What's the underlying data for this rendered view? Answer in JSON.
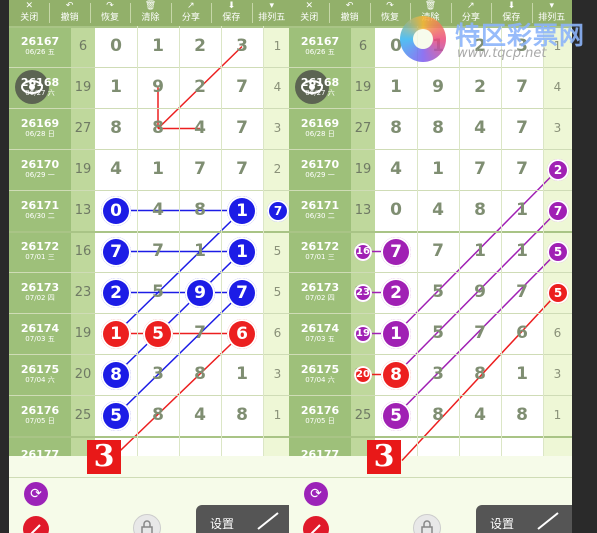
{
  "toolbar": {
    "buttons": [
      {
        "label": "关闭",
        "icon": "close-icon",
        "glyph": "✕"
      },
      {
        "label": "撤销",
        "icon": "undo-icon",
        "glyph": "↶"
      },
      {
        "label": "恢复",
        "icon": "redo-icon",
        "glyph": "↷"
      },
      {
        "label": "清除",
        "icon": "trash-icon",
        "glyph": "🗑"
      },
      {
        "label": "分享",
        "icon": "share-icon",
        "glyph": "↗"
      },
      {
        "label": "保存",
        "icon": "save-icon",
        "glyph": "⬇"
      },
      {
        "label": "排列五",
        "icon": "dropdown-icon",
        "glyph": "▾"
      }
    ]
  },
  "rows": [
    {
      "issue": "26167",
      "date": "06/26 五",
      "gap": "6",
      "digits": [
        "0",
        "1",
        "2",
        "3"
      ],
      "right": "1"
    },
    {
      "issue": "26168",
      "date": "06/27 六",
      "gap": "19",
      "digits": [
        "1",
        "9",
        "2",
        "7"
      ],
      "right": "4"
    },
    {
      "issue": "26169",
      "date": "06/28 日",
      "gap": "27",
      "digits": [
        "8",
        "8",
        "4",
        "7"
      ],
      "right": "3"
    },
    {
      "issue": "26170",
      "date": "06/29 一",
      "gap": "19",
      "digits": [
        "4",
        "1",
        "7",
        "7"
      ],
      "right": "2"
    },
    {
      "issue": "26171",
      "date": "06/30 二",
      "gap": "13",
      "digits": [
        "0",
        "4",
        "8",
        "1"
      ],
      "right": "7"
    },
    {
      "issue": "26172",
      "date": "07/01 三",
      "gap": "16",
      "digits": [
        "7",
        "7",
        "1",
        "1"
      ],
      "right": "5"
    },
    {
      "issue": "26173",
      "date": "07/02 四",
      "gap": "23",
      "digits": [
        "2",
        "5",
        "9",
        "7"
      ],
      "right": "5"
    },
    {
      "issue": "26174",
      "date": "07/03 五",
      "gap": "19",
      "digits": [
        "1",
        "5",
        "7",
        "6"
      ],
      "right": "6"
    },
    {
      "issue": "26175",
      "date": "07/04 六",
      "gap": "20",
      "digits": [
        "8",
        "3",
        "8",
        "1"
      ],
      "right": "3"
    },
    {
      "issue": "26176",
      "date": "07/05 日",
      "gap": "25",
      "digits": [
        "5",
        "8",
        "4",
        "8"
      ],
      "right": "1"
    },
    {
      "issue": "26177",
      "date": "",
      "gap": "",
      "digits": [
        "",
        "",
        "",
        ""
      ],
      "right": ""
    }
  ],
  "left_panel": {
    "highlight_balls": [
      {
        "row": 4,
        "col": 0,
        "value": "0",
        "color": "blue"
      },
      {
        "row": 4,
        "col": 3,
        "value": "1",
        "color": "blue"
      },
      {
        "row": 5,
        "col": 0,
        "value": "7",
        "color": "blue"
      },
      {
        "row": 5,
        "col": 3,
        "value": "1",
        "color": "blue"
      },
      {
        "row": 6,
        "col": 0,
        "value": "2",
        "color": "blue"
      },
      {
        "row": 6,
        "col": 2,
        "value": "9",
        "color": "blue"
      },
      {
        "row": 6,
        "col": 3,
        "value": "7",
        "color": "blue"
      },
      {
        "row": 7,
        "col": 0,
        "value": "1",
        "color": "red"
      },
      {
        "row": 7,
        "col": 1,
        "value": "5",
        "color": "red"
      },
      {
        "row": 7,
        "col": 3,
        "value": "6",
        "color": "red"
      },
      {
        "row": 8,
        "col": 0,
        "value": "8",
        "color": "blue"
      },
      {
        "row": 9,
        "col": 0,
        "value": "5",
        "color": "blue"
      }
    ],
    "right_ball": {
      "row": 4,
      "value": "7",
      "color": "blue"
    },
    "result": "3"
  },
  "right_panel": {
    "highlight_balls": [
      {
        "row": 5,
        "col": 0,
        "value": "7",
        "color": "purple"
      },
      {
        "row": 6,
        "col": 0,
        "value": "2",
        "color": "purple"
      },
      {
        "row": 7,
        "col": 0,
        "value": "1",
        "color": "purple"
      },
      {
        "row": 8,
        "col": 0,
        "value": "8",
        "color": "red"
      },
      {
        "row": 9,
        "col": 0,
        "value": "5",
        "color": "purple"
      }
    ],
    "gap_balls": [
      {
        "row": 5,
        "value": "16",
        "color": "purple"
      },
      {
        "row": 6,
        "value": "23",
        "color": "purple"
      },
      {
        "row": 7,
        "value": "19",
        "color": "purple"
      },
      {
        "row": 8,
        "value": "20",
        "color": "red"
      }
    ],
    "right_balls": [
      {
        "row": 3,
        "value": "2",
        "color": "purple"
      },
      {
        "row": 4,
        "value": "7",
        "color": "purple"
      },
      {
        "row": 5,
        "value": "5",
        "color": "purple"
      },
      {
        "row": 6,
        "value": "5",
        "color": "red"
      }
    ],
    "result": "3"
  },
  "footer": {
    "settings_label": "设置"
  },
  "watermark": {
    "name": "特区彩票网",
    "url": "www.tqcp.net"
  },
  "colors": {
    "blue": "#1c1ce6",
    "red": "#ec1f1f",
    "purple": "#a020b4",
    "green": "#9ec07a"
  }
}
